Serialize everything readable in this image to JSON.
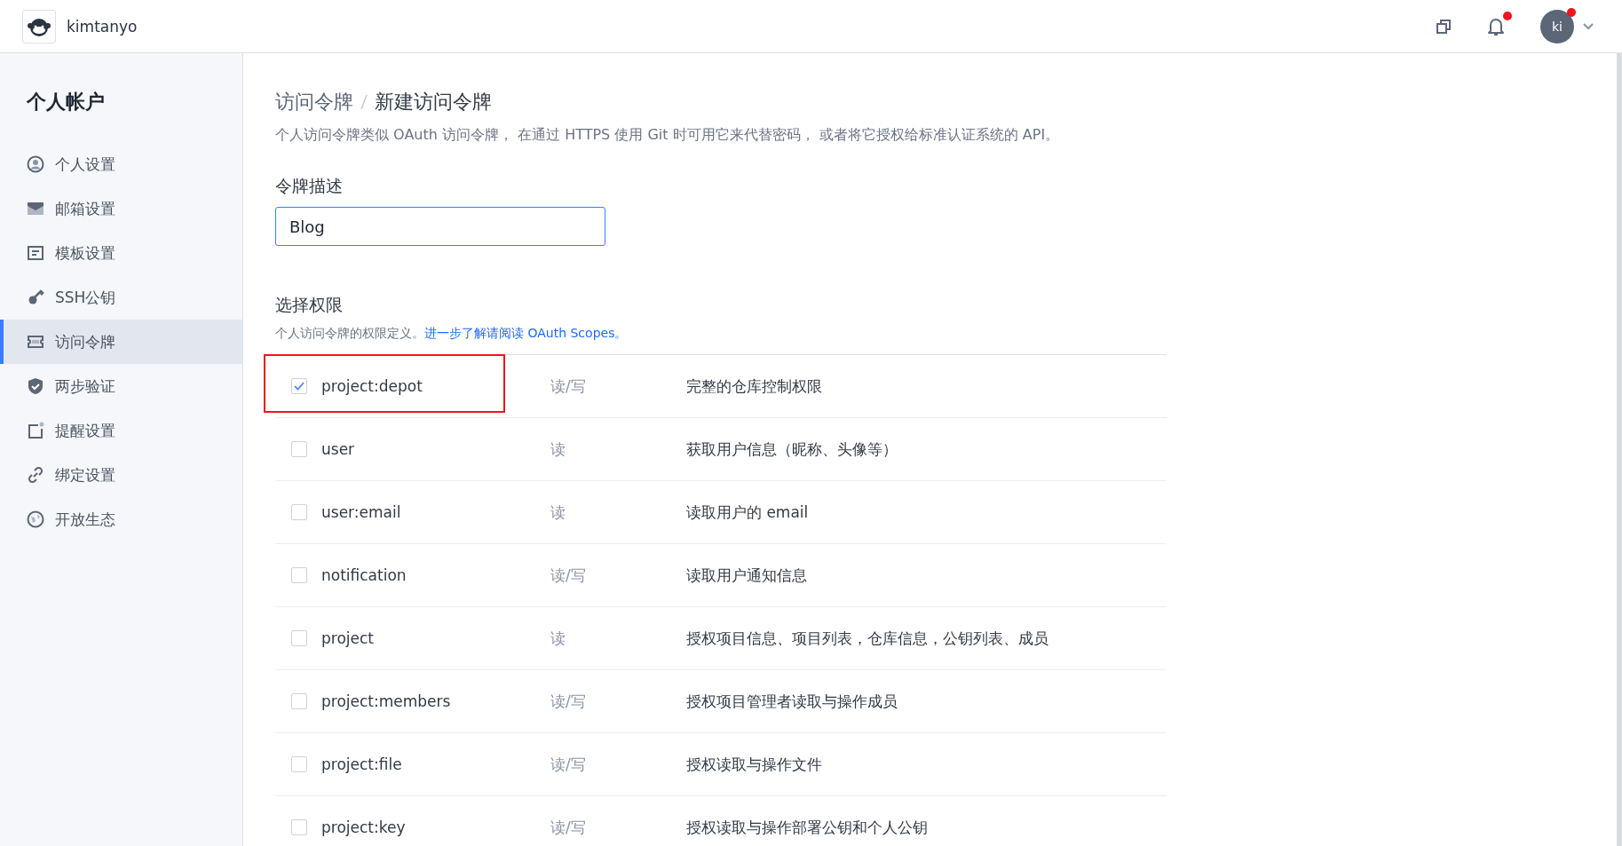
{
  "topbar": {
    "username": "kimtanyo",
    "bell_dot": true,
    "avatar": {
      "initials": "ki",
      "dot": true
    }
  },
  "sidebar": {
    "title": "个人帐户",
    "items": [
      {
        "label": "个人设置",
        "selected": false
      },
      {
        "label": "邮箱设置",
        "selected": false
      },
      {
        "label": "模板设置",
        "selected": false
      },
      {
        "label": "SSH公钥",
        "selected": false
      },
      {
        "label": "访问令牌",
        "selected": true
      },
      {
        "label": "两步验证",
        "selected": false
      },
      {
        "label": "提醒设置",
        "selected": false
      },
      {
        "label": "绑定设置",
        "selected": false
      },
      {
        "label": "开放生态",
        "selected": false
      }
    ]
  },
  "breadcrumb": [
    "访问令牌",
    "新建访问令牌"
  ],
  "description": "个人访问令牌类似 OAuth 访问令牌， 在通过 HTTPS 使用 Git 时可用它来代替密码， 或者将它授权给标准认证系统的 API。",
  "token_field": {
    "label": "令牌描述",
    "value": "Blog"
  },
  "scopes_section": {
    "title": "选择权限",
    "hint": "个人访问令牌的权限定义。",
    "link": "进一步了解请阅读 OAuth Scopes。"
  },
  "scopes": [
    {
      "name": "project:depot",
      "access": "读/写",
      "description": "完整的仓库控制权限",
      "checked": true,
      "highlighted": true
    },
    {
      "name": "user",
      "access": "读",
      "description": "获取用户信息（昵称、头像等）",
      "checked": false,
      "highlighted": false
    },
    {
      "name": "user:email",
      "access": "读",
      "description": "读取用户的 email",
      "checked": false,
      "highlighted": false
    },
    {
      "name": "notification",
      "access": "读/写",
      "description": "读取用户通知信息",
      "checked": false,
      "highlighted": false
    },
    {
      "name": "project",
      "access": "读",
      "description": "授权项目信息、项目列表，仓库信息，公钥列表、成员",
      "checked": false,
      "highlighted": false
    },
    {
      "name": "project:members",
      "access": "读/写",
      "description": "授权项目管理者读取与操作成员",
      "checked": false,
      "highlighted": false
    },
    {
      "name": "project:file",
      "access": "读/写",
      "description": "授权读取与操作文件",
      "checked": false,
      "highlighted": false
    },
    {
      "name": "project:key",
      "access": "读/写",
      "description": "授权读取与操作部署公钥和个人公钥",
      "checked": false,
      "highlighted": false
    }
  ]
}
